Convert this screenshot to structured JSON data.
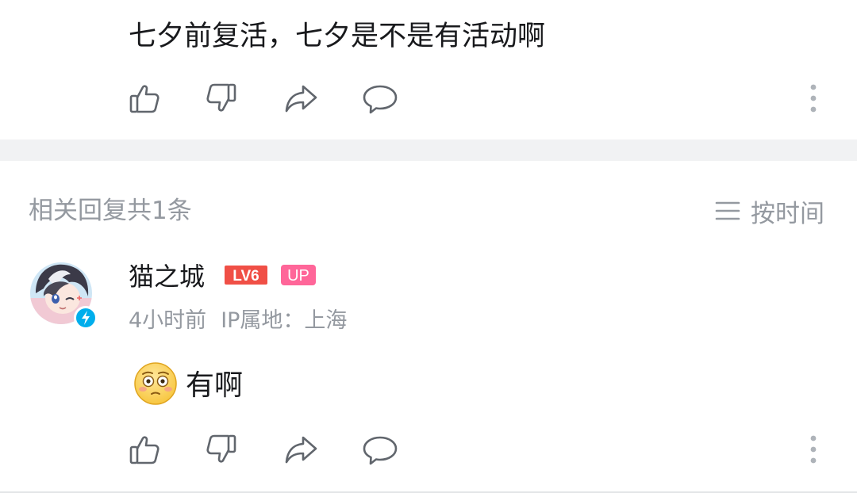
{
  "root_comment": {
    "text": "七夕前复活，七夕是不是有活动啊",
    "actions": [
      "like-icon",
      "dislike-icon",
      "share-icon",
      "reply-icon",
      "more-icon"
    ]
  },
  "replies_header": {
    "count_label": "相关回复共1条",
    "sort_label": "按时间",
    "sort_icon": "list-icon"
  },
  "reply": {
    "username": "猫之城",
    "level_badge": "LV6",
    "up_badge": "UP",
    "time": "4小时前",
    "ip_location": "IP属地：上海",
    "emoji": "flushed-face-emoji",
    "text": "有啊",
    "actions": [
      "like-icon",
      "dislike-icon",
      "share-icon",
      "reply-icon",
      "more-icon"
    ]
  },
  "colors": {
    "text_primary": "#18191c",
    "text_secondary": "#9499a0",
    "divider": "#f1f2f3",
    "level_badge": "#f04f46",
    "up_badge": "#ff6699",
    "verified": "#00aeec"
  }
}
